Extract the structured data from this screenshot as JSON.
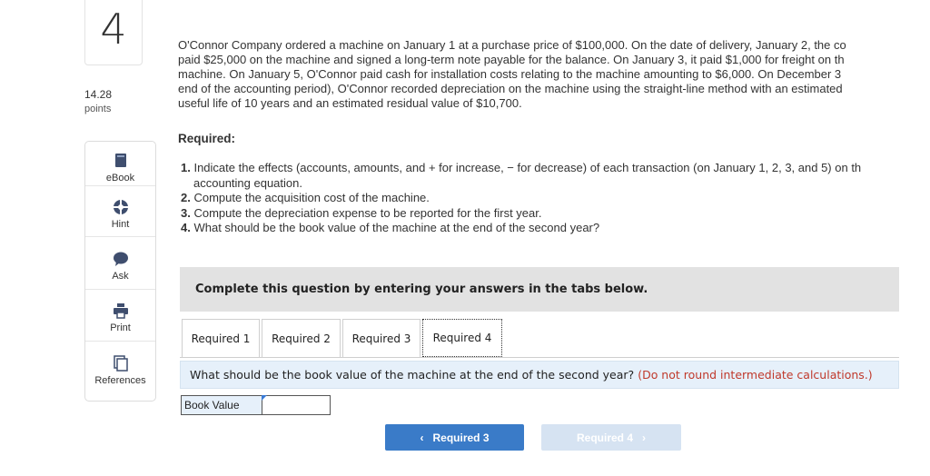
{
  "question": {
    "number": "4",
    "points_value": "14.28",
    "points_label": "points"
  },
  "tools": [
    {
      "label": "eBook",
      "icon": "book-icon"
    },
    {
      "label": "Hint",
      "icon": "hint-icon"
    },
    {
      "label": "Ask",
      "icon": "chat-bubble-icon"
    },
    {
      "label": "Print",
      "icon": "printer-icon"
    },
    {
      "label": "References",
      "icon": "documents-icon"
    }
  ],
  "problem": {
    "lines": [
      "O'Connor Company ordered a machine on January 1 at a purchase price of $100,000. On the date of delivery, January 2, the co",
      "paid $25,000 on the machine and signed a long-term note payable for the balance. On January 3, it paid $1,000 for freight on th",
      "machine. On January 5, O'Connor paid cash for installation costs relating to the machine amounting to $6,000. On December 3",
      "end of the accounting period), O'Connor recorded depreciation on the machine using the straight-line method with an estimated",
      "useful life of 10 years and an estimated residual value of $10,700."
    ]
  },
  "required": {
    "heading": "Required:",
    "items": [
      {
        "num": "1.",
        "text": "Indicate the effects (accounts, amounts, and + for increase, − for decrease) of each transaction (on January 1, 2, 3, and 5) on th",
        "cont": "accounting equation."
      },
      {
        "num": "2.",
        "text": "Compute the acquisition cost of the machine."
      },
      {
        "num": "3.",
        "text": "Compute the depreciation expense to be reported for the first year."
      },
      {
        "num": "4.",
        "text": "What should be the book value of the machine at the end of the second year?"
      }
    ]
  },
  "instruction": "Complete this question by entering your answers in the tabs below.",
  "tabs": [
    "Required 1",
    "Required 2",
    "Required 3",
    "Required 4"
  ],
  "active_tab": "Required 4",
  "prompt": {
    "text": "What should be the book value of the machine at the end of the second year?",
    "note": "(Do not round intermediate calculations.)"
  },
  "answer": {
    "label": "Book Value",
    "value": ""
  },
  "nav": {
    "prev_label": "Required 3",
    "prev_arrow": "‹",
    "next_label": "Required 4",
    "next_arrow": "›"
  },
  "colors": {
    "accent": "#3a7bc8",
    "disabled": "#d6e3f2",
    "note_red": "#c0392b",
    "prompt_bg": "#e6f0fa"
  }
}
